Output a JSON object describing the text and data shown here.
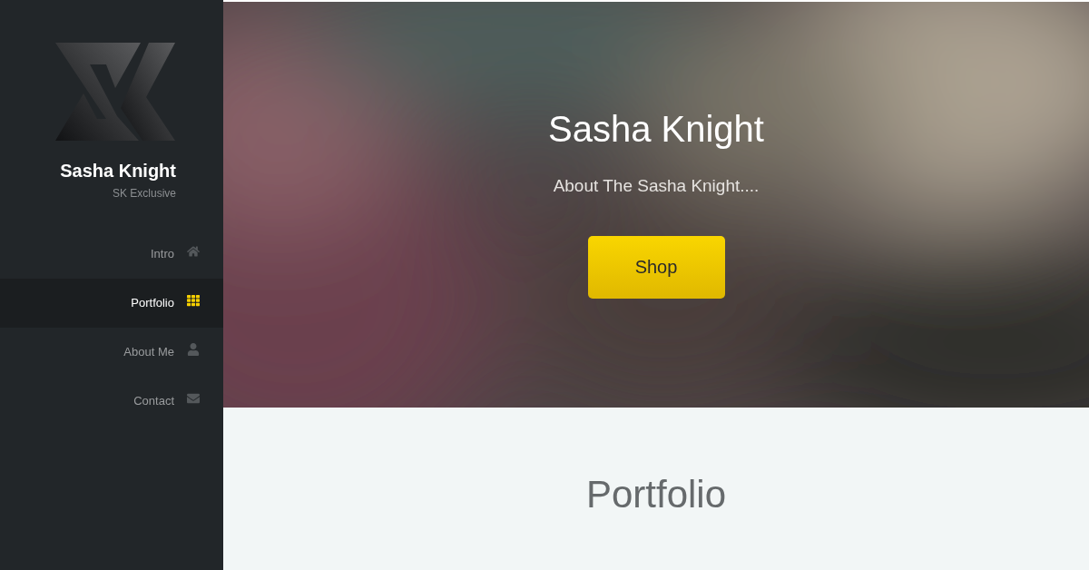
{
  "sidebar": {
    "name": "Sasha Knight",
    "tagline": "SK Exclusive",
    "items": [
      {
        "label": "Intro",
        "kind": "home",
        "selected": false
      },
      {
        "label": "Portfolio",
        "kind": "grid",
        "selected": true
      },
      {
        "label": "About Me",
        "kind": "person",
        "selected": false
      },
      {
        "label": "Contact",
        "kind": "mail",
        "selected": false
      }
    ]
  },
  "hero": {
    "title": "Sasha Knight",
    "subtitle": "About The Sasha Knight....",
    "button": "Shop"
  },
  "section": {
    "title": "Portfolio"
  }
}
